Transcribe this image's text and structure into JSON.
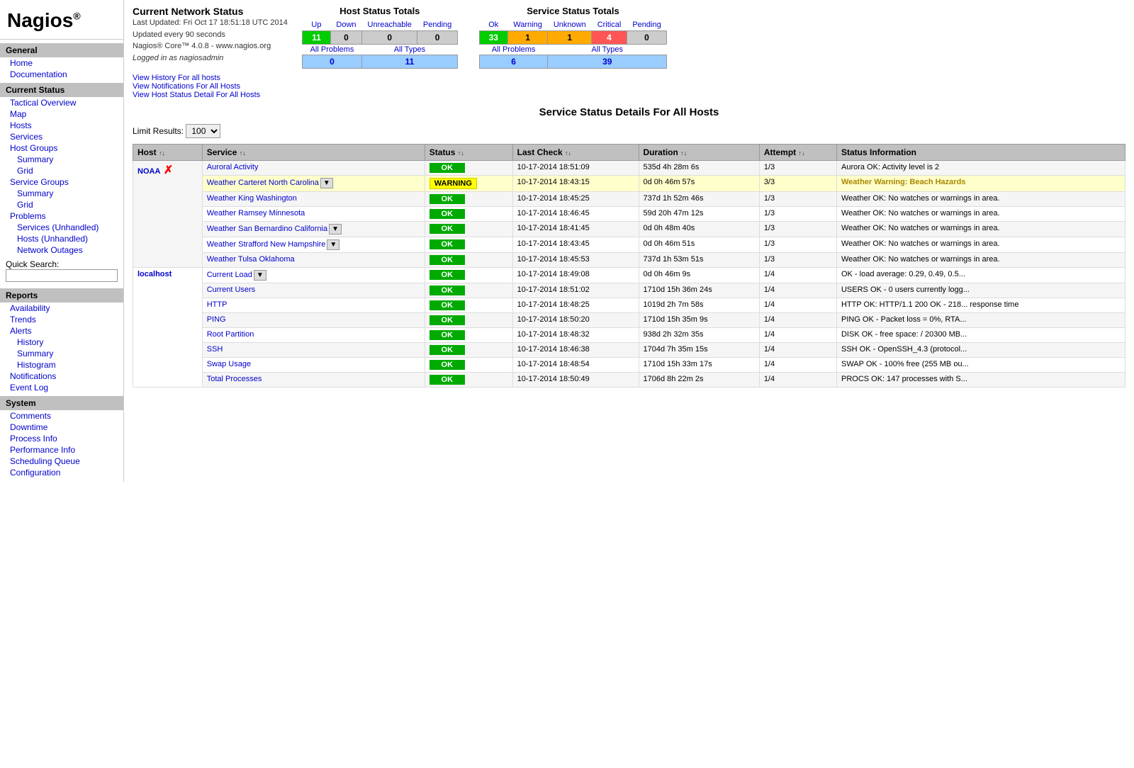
{
  "logo": {
    "text": "Nagios",
    "reg": "®"
  },
  "sidebar": {
    "general_header": "General",
    "general_items": [
      {
        "label": "Home",
        "name": "home"
      },
      {
        "label": "Documentation",
        "name": "documentation"
      }
    ],
    "current_status_header": "Current Status",
    "current_status_items": [
      {
        "label": "Tactical Overview",
        "name": "tactical-overview",
        "indent": false
      },
      {
        "label": "Map",
        "name": "map",
        "indent": false
      },
      {
        "label": "Hosts",
        "name": "hosts",
        "indent": false
      },
      {
        "label": "Services",
        "name": "services",
        "indent": false
      },
      {
        "label": "Host Groups",
        "name": "host-groups",
        "indent": false
      },
      {
        "label": "Summary",
        "name": "hg-summary",
        "indent": true
      },
      {
        "label": "Grid",
        "name": "hg-grid",
        "indent": true
      },
      {
        "label": "Service Groups",
        "name": "service-groups",
        "indent": false
      },
      {
        "label": "Summary",
        "name": "sg-summary",
        "indent": true
      },
      {
        "label": "Grid",
        "name": "sg-grid",
        "indent": true
      },
      {
        "label": "Problems",
        "name": "problems",
        "indent": false
      },
      {
        "label": "Services (Unhandled)",
        "name": "services-unhandled",
        "indent": true
      },
      {
        "label": "Hosts (Unhandled)",
        "name": "hosts-unhandled",
        "indent": true
      },
      {
        "label": "Network Outages",
        "name": "network-outages",
        "indent": true
      }
    ],
    "quick_search_label": "Quick Search:",
    "reports_header": "Reports",
    "reports_items": [
      {
        "label": "Availability",
        "name": "availability",
        "indent": false
      },
      {
        "label": "Trends",
        "name": "trends",
        "indent": false
      },
      {
        "label": "Alerts",
        "name": "alerts",
        "indent": false
      },
      {
        "label": "History",
        "name": "alerts-history",
        "indent": true
      },
      {
        "label": "Summary",
        "name": "alerts-summary",
        "indent": true
      },
      {
        "label": "Histogram",
        "name": "alerts-histogram",
        "indent": true
      },
      {
        "label": "Notifications",
        "name": "notifications",
        "indent": false
      },
      {
        "label": "Event Log",
        "name": "event-log",
        "indent": false
      }
    ],
    "system_header": "System",
    "system_items": [
      {
        "label": "Comments",
        "name": "comments",
        "indent": false
      },
      {
        "label": "Downtime",
        "name": "downtime",
        "indent": false
      },
      {
        "label": "Process Info",
        "name": "process-info",
        "indent": false
      },
      {
        "label": "Performance Info",
        "name": "performance-info",
        "indent": false
      },
      {
        "label": "Scheduling Queue",
        "name": "scheduling-queue",
        "indent": false
      },
      {
        "label": "Configuration",
        "name": "configuration",
        "indent": false
      }
    ]
  },
  "header": {
    "network_status_title": "Current Network Status",
    "last_updated": "Last Updated: Fri Oct 17 18:51:18 UTC 2014",
    "update_interval": "Updated every 90 seconds",
    "version": "Nagios® Core™ 4.0.8 - www.nagios.org",
    "logged_in": "Logged in as nagiosadmin",
    "link1": "View History For all hosts",
    "link2": "View Notifications For All Hosts",
    "link3": "View Host Status Detail For All Hosts"
  },
  "host_status_totals": {
    "title": "Host Status Totals",
    "headers": [
      "Up",
      "Down",
      "Unreachable",
      "Pending"
    ],
    "values": [
      "11",
      "0",
      "0",
      "0"
    ],
    "all_problems_label": "All Problems",
    "all_types_label": "All Types",
    "sub_values": [
      "0",
      "11"
    ]
  },
  "service_status_totals": {
    "title": "Service Status Totals",
    "headers": [
      "Ok",
      "Warning",
      "Unknown",
      "Critical",
      "Pending"
    ],
    "values": [
      "33",
      "1",
      "1",
      "4",
      "0"
    ],
    "all_problems_label": "All Problems",
    "all_types_label": "All Types",
    "sub_values": [
      "6",
      "39"
    ]
  },
  "service_details": {
    "page_title": "Service Status Details For All Hosts",
    "limit_label": "Limit Results:",
    "limit_value": "100",
    "columns": [
      "Host",
      "Service",
      "Status",
      "Last Check",
      "Duration",
      "Attempt",
      "Status Information"
    ],
    "rows": [
      {
        "host": "NOAA",
        "host_rowspan": 7,
        "show_x": true,
        "service": "Auroral Activity",
        "show_dropdown": false,
        "status": "OK",
        "status_class": "ok",
        "last_check": "10-17-2014 18:51:09",
        "duration": "535d 4h 28m 6s",
        "attempt": "1/3",
        "info": "Aurora OK: Activity level is 2",
        "row_class": "row-odd"
      },
      {
        "host": "",
        "show_dropdown": true,
        "service": "Weather Carteret North Carolina",
        "status": "WARNING",
        "status_class": "warning",
        "last_check": "10-17-2014 18:43:15",
        "duration": "0d 0h 46m 57s",
        "attempt": "3/3",
        "info": "Weather Warning: Beach Hazards",
        "row_class": "row-warning"
      },
      {
        "host": "",
        "show_dropdown": false,
        "service": "Weather King Washington",
        "status": "OK",
        "status_class": "ok",
        "last_check": "10-17-2014 18:45:25",
        "duration": "737d 1h 52m 46s",
        "attempt": "1/3",
        "info": "Weather OK: No watches or warnings in area.",
        "row_class": "row-odd"
      },
      {
        "host": "",
        "show_dropdown": false,
        "service": "Weather Ramsey Minnesota",
        "status": "OK",
        "status_class": "ok",
        "last_check": "10-17-2014 18:46:45",
        "duration": "59d 20h 47m 12s",
        "attempt": "1/3",
        "info": "Weather OK: No watches or warnings in area.",
        "row_class": "row-even"
      },
      {
        "host": "",
        "show_dropdown": true,
        "service": "Weather San Bernardino California",
        "status": "OK",
        "status_class": "ok",
        "last_check": "10-17-2014 18:41:45",
        "duration": "0d 0h 48m 40s",
        "attempt": "1/3",
        "info": "Weather OK: No watches or warnings in area.",
        "row_class": "row-odd"
      },
      {
        "host": "",
        "show_dropdown": true,
        "service": "Weather Strafford New Hampshire",
        "status": "OK",
        "status_class": "ok",
        "last_check": "10-17-2014 18:43:45",
        "duration": "0d 0h 46m 51s",
        "attempt": "1/3",
        "info": "Weather OK: No watches or warnings in area.",
        "row_class": "row-even"
      },
      {
        "host": "",
        "show_dropdown": false,
        "service": "Weather Tulsa Oklahoma",
        "status": "OK",
        "status_class": "ok",
        "last_check": "10-17-2014 18:45:53",
        "duration": "737d 1h 53m 51s",
        "attempt": "1/3",
        "info": "Weather OK: No watches or warnings in area.",
        "row_class": "row-odd"
      },
      {
        "host": "localhost",
        "host_rowspan": 9,
        "show_x": false,
        "show_dropdown": true,
        "service": "Current Load",
        "status": "OK",
        "status_class": "ok",
        "last_check": "10-17-2014 18:49:08",
        "duration": "0d 0h 46m 9s",
        "attempt": "1/4",
        "info": "OK - load average: 0.29, 0.49, 0.5...",
        "row_class": "row-even"
      },
      {
        "host": "",
        "show_dropdown": false,
        "service": "Current Users",
        "status": "OK",
        "status_class": "ok",
        "last_check": "10-17-2014 18:51:02",
        "duration": "1710d 15h 36m 24s",
        "attempt": "1/4",
        "info": "USERS OK - 0 users currently logg...",
        "row_class": "row-odd"
      },
      {
        "host": "",
        "show_dropdown": false,
        "service": "HTTP",
        "status": "OK",
        "status_class": "ok",
        "last_check": "10-17-2014 18:48:25",
        "duration": "1019d 2h 7m 58s",
        "attempt": "1/4",
        "info": "HTTP OK: HTTP/1.1 200 OK - 218... response time",
        "row_class": "row-even"
      },
      {
        "host": "",
        "show_dropdown": false,
        "service": "PING",
        "status": "OK",
        "status_class": "ok",
        "last_check": "10-17-2014 18:50:20",
        "duration": "1710d 15h 35m 9s",
        "attempt": "1/4",
        "info": "PING OK - Packet loss = 0%, RTA...",
        "row_class": "row-odd"
      },
      {
        "host": "",
        "show_dropdown": false,
        "service": "Root Partition",
        "status": "OK",
        "status_class": "ok",
        "last_check": "10-17-2014 18:48:32",
        "duration": "938d 2h 32m 35s",
        "attempt": "1/4",
        "info": "DISK OK - free space: / 20300 MB...",
        "row_class": "row-even"
      },
      {
        "host": "",
        "show_dropdown": false,
        "service": "SSH",
        "status": "OK",
        "status_class": "ok",
        "last_check": "10-17-2014 18:46:38",
        "duration": "1704d 7h 35m 15s",
        "attempt": "1/4",
        "info": "SSH OK - OpenSSH_4.3 (protocol...",
        "row_class": "row-odd"
      },
      {
        "host": "",
        "show_dropdown": false,
        "service": "Swap Usage",
        "status": "OK",
        "status_class": "ok",
        "last_check": "10-17-2014 18:48:54",
        "duration": "1710d 15h 33m 17s",
        "attempt": "1/4",
        "info": "SWAP OK - 100% free (255 MB ou...",
        "row_class": "row-even"
      },
      {
        "host": "",
        "show_dropdown": false,
        "service": "Total Processes",
        "status": "OK",
        "status_class": "ok",
        "last_check": "10-17-2014 18:50:49",
        "duration": "1706d 8h 22m 2s",
        "attempt": "1/4",
        "info": "PROCS OK: 147 processes with S...",
        "row_class": "row-odd"
      }
    ]
  }
}
